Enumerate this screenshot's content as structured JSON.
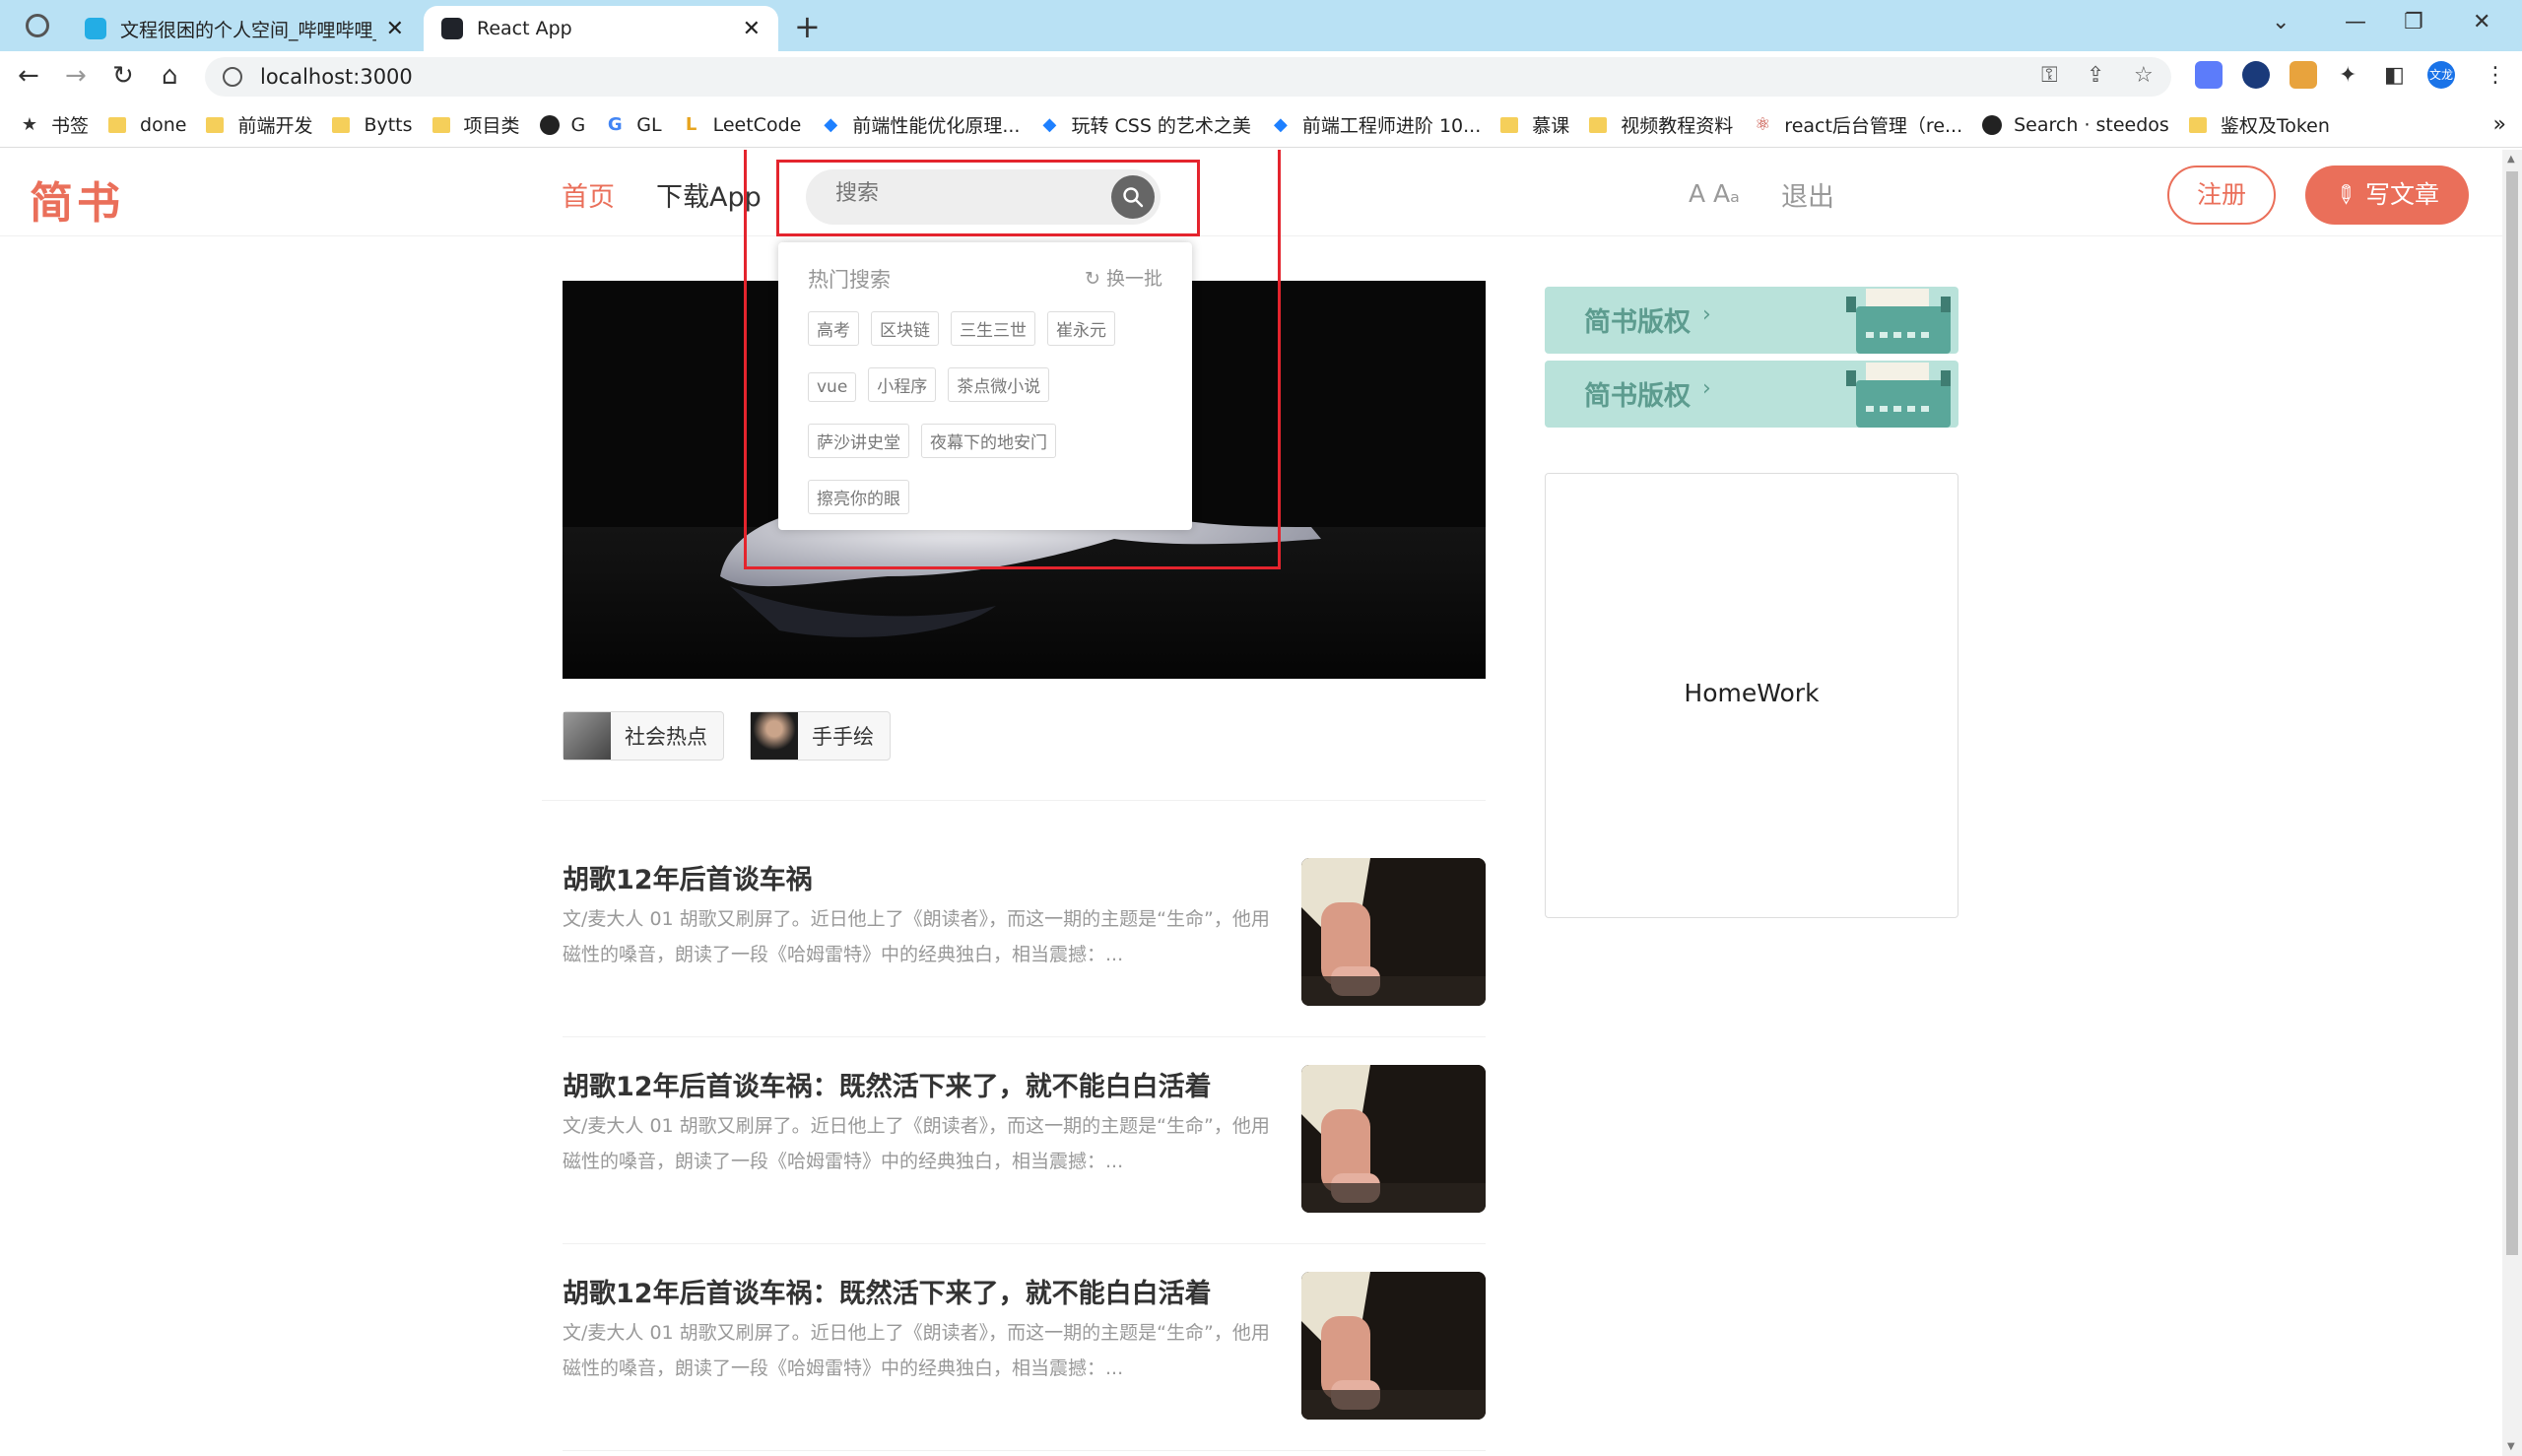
{
  "browser": {
    "tabs": [
      {
        "title": "文程很困的个人空间_哔哩哔哩_b",
        "active": false
      },
      {
        "title": "React App",
        "active": true
      }
    ],
    "url": "localhost:3000",
    "bookmarks": [
      {
        "icon": "star-icon",
        "label": "书签"
      },
      {
        "icon": "folder-icon",
        "label": "done"
      },
      {
        "icon": "folder-icon",
        "label": "前端开发"
      },
      {
        "icon": "folder-icon",
        "label": "Bytts"
      },
      {
        "icon": "folder-icon",
        "label": "项目类"
      },
      {
        "icon": "github-icon",
        "label": "G"
      },
      {
        "icon": "google-icon",
        "label": "GL"
      },
      {
        "icon": "leetcode-icon",
        "label": "LeetCode"
      },
      {
        "icon": "juejin-icon",
        "label": "前端性能优化原理..."
      },
      {
        "icon": "juejin-icon",
        "label": "玩转 CSS 的艺术之美"
      },
      {
        "icon": "juejin-icon",
        "label": "前端工程师进阶 10..."
      },
      {
        "icon": "folder-icon",
        "label": "慕课"
      },
      {
        "icon": "folder-icon",
        "label": "视频教程资料"
      },
      {
        "icon": "react-icon",
        "label": "react后台管理（re..."
      },
      {
        "icon": "github-icon",
        "label": "Search · steedos"
      },
      {
        "icon": "folder-icon",
        "label": "鉴权及Token"
      }
    ],
    "more": "»",
    "profile_label": "文龙"
  },
  "header": {
    "logo": "简书",
    "nav_home": "首页",
    "nav_app": "下载App",
    "search_placeholder": "搜索",
    "font_toggle": "A Aₐ",
    "logout": "退出",
    "register": "注册",
    "write": "写文章"
  },
  "hot_search": {
    "title": "热门搜索",
    "switch": "换一批",
    "tags": [
      "高考",
      "区块链",
      "三生三世",
      "崔永元",
      "vue",
      "小程序",
      "茶点微小说",
      "萨沙讲史堂",
      "夜幕下的地安门",
      "擦亮你的眼"
    ]
  },
  "topics": [
    {
      "label": "社会热点"
    },
    {
      "label": "手手绘"
    }
  ],
  "articles": [
    {
      "title": "胡歌12年后首谈车祸",
      "abstract": "文/麦大人 01 胡歌又刷屏了。近日他上了《朗读者》，而这一期的主题是“生命”，他用磁性的嗓音，朗读了一段《哈姆雷特》中的经典独白，相当震撼：..."
    },
    {
      "title": "胡歌12年后首谈车祸：既然活下来了，就不能白白活着",
      "abstract": "文/麦大人 01 胡歌又刷屏了。近日他上了《朗读者》，而这一期的主题是“生命”，他用磁性的嗓音，朗读了一段《哈姆雷特》中的经典独白，相当震撼：..."
    },
    {
      "title": "胡歌12年后首谈车祸：既然活下来了，就不能白白活着",
      "abstract": "文/麦大人 01 胡歌又刷屏了。近日他上了《朗读者》，而这一期的主题是“生命”，他用磁性的嗓音，朗读了一段《哈姆雷特》中的经典独白，相当震撼：..."
    }
  ],
  "sidebar": {
    "banners": [
      {
        "label": "简书版权"
      },
      {
        "label": "简书版权"
      }
    ],
    "homework": "HomeWork"
  },
  "colors": {
    "brand": "#ea6f5a",
    "highlight": "#e4242d",
    "tabbar": "#b9e1f4"
  }
}
